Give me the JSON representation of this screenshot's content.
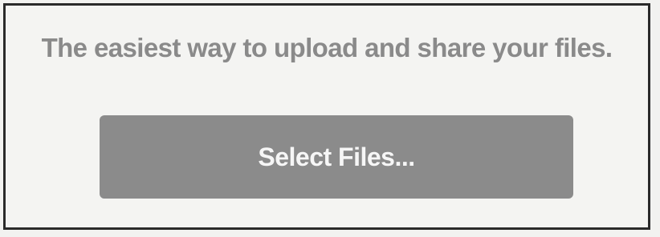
{
  "upload_panel": {
    "headline": "The easiest way to upload and share your files.",
    "select_button_label": "Select Files..."
  },
  "colors": {
    "headline_text": "#8a8a8a",
    "button_background": "#8b8b8b",
    "button_text": "#f6f6f6",
    "frame_border": "#2a2a2a"
  }
}
